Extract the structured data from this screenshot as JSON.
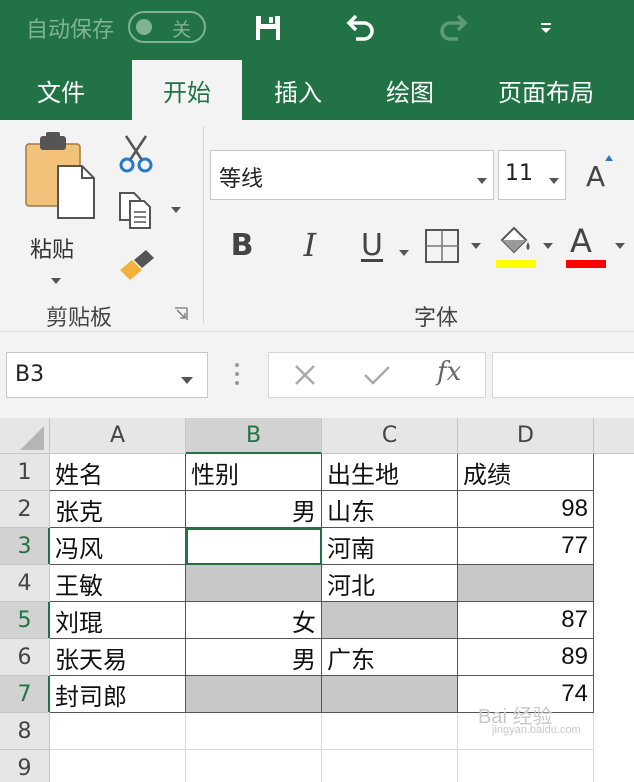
{
  "titlebar": {
    "autosave_label": "自动保存",
    "autosave_state": "关",
    "icons": [
      "save-icon",
      "undo-icon",
      "redo-icon",
      "customize-quick-access-icon"
    ]
  },
  "tabs": [
    {
      "label": "文件",
      "active": false
    },
    {
      "label": "开始",
      "active": true
    },
    {
      "label": "插入",
      "active": false
    },
    {
      "label": "绘图",
      "active": false
    },
    {
      "label": "页面布局",
      "active": false
    }
  ],
  "ribbon": {
    "clipboard": {
      "paste_label": "粘贴",
      "group_label": "剪贴板",
      "icons": [
        "paste-icon",
        "cut-icon",
        "copy-icon",
        "format-painter-icon",
        "dialog-launcher-icon"
      ]
    },
    "font": {
      "font_name": "等线",
      "font_size": "11",
      "group_label": "字体",
      "bold": "B",
      "italic": "I",
      "underline": "U",
      "font_color_glyph": "A",
      "grow_font_glyph": "A",
      "highlight_color": "#ffff00",
      "font_color": "#ff0000"
    }
  },
  "formula_bar": {
    "name_box": "B3",
    "fx_label": "fx",
    "formula": ""
  },
  "sheet": {
    "columns": [
      "A",
      "B",
      "C",
      "D"
    ],
    "selected_column": "B",
    "rows": [
      "1",
      "2",
      "3",
      "4",
      "5",
      "6",
      "7",
      "8",
      "9"
    ],
    "selected_rows": [
      "3",
      "5",
      "7"
    ],
    "cells": {
      "r1": [
        "姓名",
        "性别",
        "出生地",
        "成绩"
      ],
      "r2": [
        "张克",
        "男",
        "山东",
        "98"
      ],
      "r3": [
        "冯风",
        "",
        "河南",
        "77"
      ],
      "r4": [
        "王敏",
        "",
        "河北",
        ""
      ],
      "r5": [
        "刘琨",
        "女",
        "",
        "87"
      ],
      "r6": [
        "张天易",
        "男",
        "广东",
        "89"
      ],
      "r7": [
        "封司郎",
        "",
        "",
        "74"
      ]
    },
    "accent_color": "#217346",
    "shade_color": "#c8c8c8"
  },
  "watermark": {
    "text": "Bai 经验",
    "sub": "jingyan.baidu.com"
  }
}
